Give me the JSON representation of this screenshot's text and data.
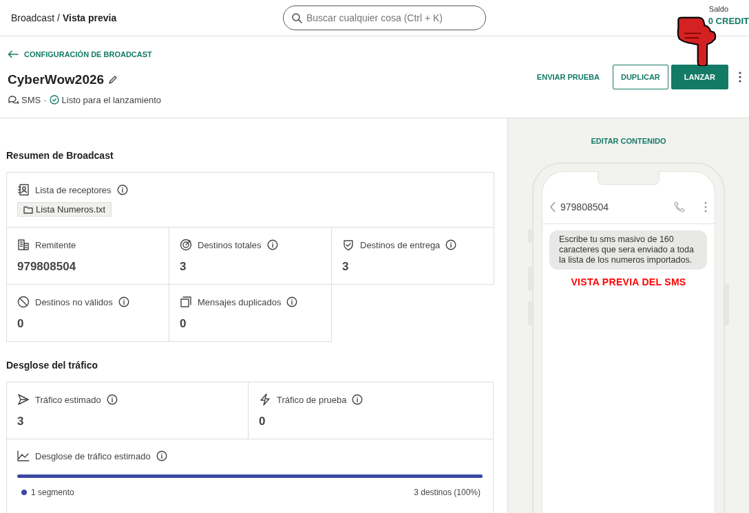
{
  "header": {
    "breadcrumb": {
      "parent": "Broadcast",
      "separator": "/",
      "current": "Vista previa"
    },
    "search": {
      "placeholder": "Buscar cualquier cosa (Ctrl + K)"
    },
    "balance": {
      "label": "Saldo",
      "value": "0 CREDIT"
    }
  },
  "back_link": "CONFIGURACIÓN DE BROADCAST",
  "title": "CyberWow2026",
  "channel": "SMS",
  "separator": "·",
  "status": "Listo para el lanzamiento",
  "actions": [
    {
      "label": "ENVIAR PRUEBA",
      "kind": "text"
    },
    {
      "label": "DUPLICAR",
      "kind": "outline"
    },
    {
      "label": "LANZAR",
      "kind": "primary"
    }
  ],
  "summary": {
    "title": "Resumen de Broadcast",
    "recipients": {
      "label": "Lista de receptores",
      "file": "Lista Numeros.txt"
    },
    "stats": [
      {
        "kind": "sender",
        "label": "Remitente",
        "info": false,
        "value": "979808504"
      },
      {
        "kind": "total",
        "label": "Destinos totales",
        "info": true,
        "value": "3"
      },
      {
        "kind": "delivery",
        "label": "Destinos de entrega",
        "info": true,
        "value": "3"
      },
      {
        "kind": "invalid",
        "label": "Destinos no válidos",
        "info": true,
        "value": "0"
      },
      {
        "kind": "duplicate",
        "label": "Mensajes duplicados",
        "info": true,
        "value": "0"
      }
    ]
  },
  "traffic": {
    "title": "Desglose del tráfico",
    "stats": [
      {
        "kind": "estimated",
        "label": "Tráfico estimado",
        "info": true,
        "value": "3"
      },
      {
        "kind": "test",
        "label": "Tráfico de prueba",
        "info": true,
        "value": "0"
      }
    ],
    "breakdown": {
      "label": "Desglose de tráfico estimado",
      "level": 1,
      "legend": {
        "label": "1 segmento",
        "color": "#3b49a3"
      },
      "total": "3 destinos (100%)"
    }
  },
  "preview": {
    "edit_link": "EDITAR CONTENIDO",
    "contact": "979808504",
    "message": "Escribe tu sms masivo de 160 caracteres que sera enviado a toda la lista de los numeros importados.",
    "annotation": "VISTA PREVIA DEL SMS"
  }
}
